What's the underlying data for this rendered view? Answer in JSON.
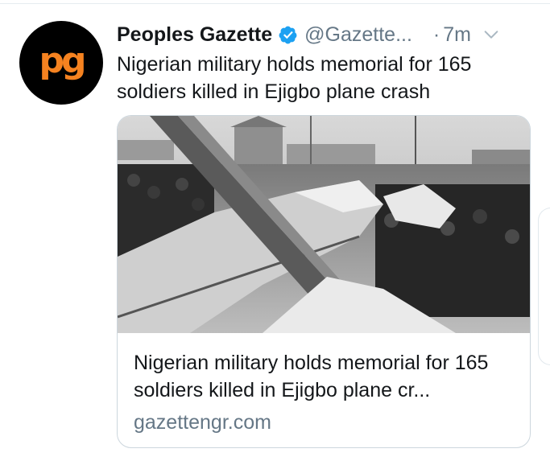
{
  "tweet": {
    "display_name": "Peoples Gazette",
    "handle": "@Gazette...",
    "separator": "·",
    "time": "7m",
    "avatar_text": "pg",
    "text": "Nigerian military holds memorial for 165 soldiers killed in Ejigbo plane crash"
  },
  "card": {
    "title": "Nigerian military holds memorial for 165 soldiers killed in Ejigbo plane cr...",
    "domain": "gazettengr.com",
    "image_icon": "plane-crash-photo"
  },
  "icons": {
    "verified": "verified-badge-icon",
    "more": "chevron-down-icon"
  },
  "colors": {
    "verified_blue": "#1da1f2",
    "avatar_orange": "#f58220",
    "secondary_text": "#657786",
    "primary_text": "#14171a"
  }
}
